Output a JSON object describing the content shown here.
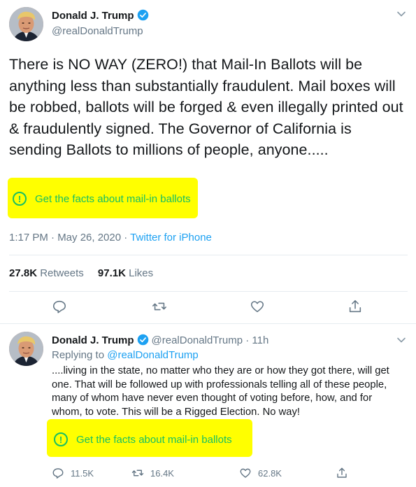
{
  "main_tweet": {
    "author_name": "Donald J. Trump",
    "handle": "@realDonaldTrump",
    "text": "There is NO WAY (ZERO!) that Mail-In Ballots will be anything less than substantially fraudulent. Mail boxes will be robbed, ballots will be forged & even illegally printed out & fraudulently signed. The Governor of California is sending Ballots to millions of people, anyone.....",
    "fact_check_label": "Get the facts about mail-in ballots",
    "timestamp": "1:17 PM · May 26, 2020 · ",
    "source": "Twitter for iPhone",
    "retweets_count": "27.8K",
    "retweets_label": "Retweets",
    "likes_count": "97.1K",
    "likes_label": "Likes"
  },
  "reply_tweet": {
    "author_name": "Donald J. Trump",
    "handle_time": "@realDonaldTrump · 11h",
    "replying_to_label": "Replying to ",
    "replying_to_handle": "@realDonaldTrump",
    "text": "....living in the state, no matter who they are or how they got there, will get one. That will be followed up with professionals telling all of these people, many of whom have never even thought of voting before, how, and for whom, to vote. This will be a Rigged Election. No way!",
    "fact_check_label": "Get the facts about mail-in ballots",
    "reply_count": "11.5K",
    "retweet_count": "16.4K",
    "like_count": "62.8K"
  },
  "icons": [
    "verified-badge-icon",
    "chevron-down-icon",
    "exclamation-circle-icon",
    "reply-icon",
    "retweet-icon",
    "like-icon",
    "share-icon"
  ],
  "colors": {
    "highlight": "#ffff00",
    "fact_check_green": "#17bf63",
    "link_blue": "#1da1f2",
    "muted_gray": "#657786"
  }
}
